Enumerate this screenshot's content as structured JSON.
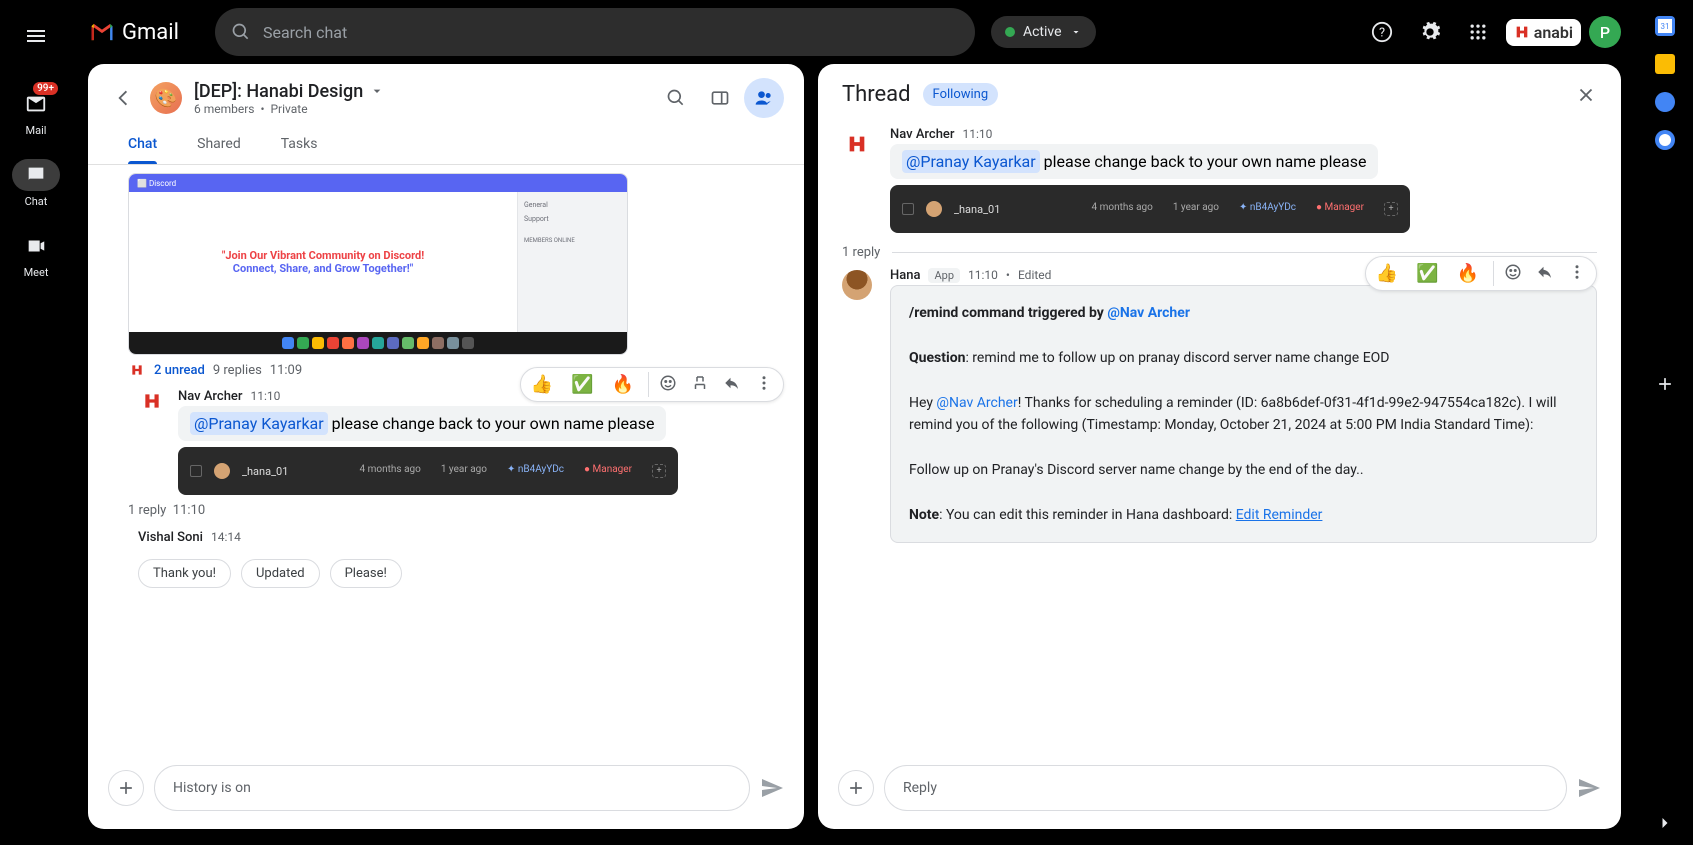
{
  "nav": {
    "mail": "Mail",
    "chat": "Chat",
    "meet": "Meet",
    "badge": "99+"
  },
  "topbar": {
    "brand": "Gmail",
    "search_placeholder": "Search chat",
    "status": "Active",
    "hanabi_label": "anabi",
    "avatar_letter": "P"
  },
  "space": {
    "title": "[DEP]: Hanabi Design",
    "members": "6 members",
    "privacy": "Private",
    "tabs": {
      "chat": "Chat",
      "shared": "Shared",
      "tasks": "Tasks"
    }
  },
  "preview": {
    "discord_join_l1": "\"Join Our Vibrant Community on Discord!",
    "discord_join_l2": "Connect, Share, and Grow Together!\"",
    "side_general": "General",
    "side_support": "Support",
    "side_head": "MEMBERS ONLINE",
    "bar_name": "_hana_01",
    "bar_t1": "4 months ago",
    "bar_t2": "1 year ago",
    "bar_code": "nB4AyYDc",
    "bar_role": "Manager"
  },
  "thread_info": {
    "unread": "2 unread",
    "replies": "9 replies",
    "time": "11:09"
  },
  "msg1": {
    "author": "Nav Archer",
    "time": "11:10",
    "mention": "@Pranay Kayarkar",
    "text": " please change back to your own name please"
  },
  "reply1": {
    "count": "1 reply",
    "time": "11:10"
  },
  "msg2": {
    "author": "Vishal Soni",
    "time": "14:14"
  },
  "reactions": {
    "r1": "👍",
    "r2": "✅",
    "r3": "🔥"
  },
  "suggestions": {
    "s1": "Thank you!",
    "s2": "Updated",
    "s3": "Please!"
  },
  "compose": {
    "history": "History is on",
    "reply": "Reply"
  },
  "thread": {
    "title": "Thread",
    "following": "Following",
    "m1": {
      "author": "Nav Archer",
      "time": "11:10",
      "mention": "@Pranay Kayarkar",
      "text": " please change back to your own name please"
    },
    "divider": "1 reply",
    "m2": {
      "author": "Hana",
      "app": "App",
      "time": "11:10",
      "edited": "Edited",
      "trigger_prefix": "/remind command triggered by ",
      "trigger_mention": "@Nav Archer",
      "q_label": "Question",
      "q_text": ": remind me to follow up on pranay discord server name change EOD",
      "body_pre": "Hey ",
      "body_mention": "@Nav Archer",
      "body_post": "! Thanks for scheduling a reminder (ID: 6a8b6def-0f31-4f1d-99e2-947554ca182c). I will remind you of the following (Timestamp: Monday, October 21, 2024 at 5:00 PM India Standard Time):",
      "followup": "Follow up on Pranay's Discord server name change by the end of the day..",
      "note_label": "Note",
      "note_text": ": You can edit this reminder in Hana dashboard: ",
      "note_link": "Edit Reminder"
    }
  }
}
